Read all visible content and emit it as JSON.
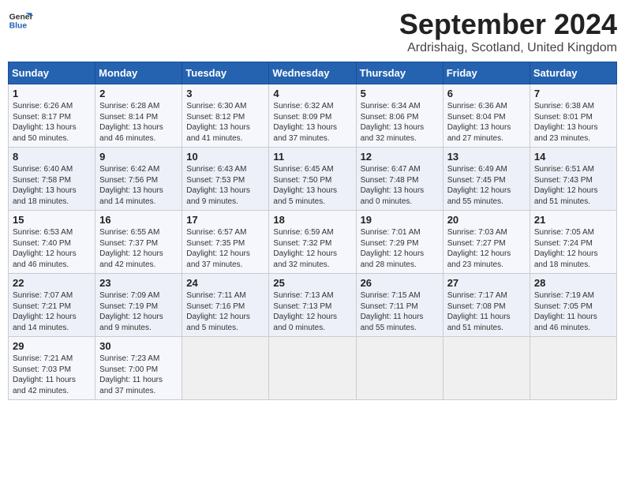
{
  "logo": {
    "line1": "General",
    "line2": "Blue"
  },
  "title": "September 2024",
  "subtitle": "Ardrishaig, Scotland, United Kingdom",
  "days_of_week": [
    "Sunday",
    "Monday",
    "Tuesday",
    "Wednesday",
    "Thursday",
    "Friday",
    "Saturday"
  ],
  "weeks": [
    [
      {
        "day": "1",
        "sunrise": "Sunrise: 6:26 AM",
        "sunset": "Sunset: 8:17 PM",
        "daylight": "Daylight: 13 hours and 50 minutes."
      },
      {
        "day": "2",
        "sunrise": "Sunrise: 6:28 AM",
        "sunset": "Sunset: 8:14 PM",
        "daylight": "Daylight: 13 hours and 46 minutes."
      },
      {
        "day": "3",
        "sunrise": "Sunrise: 6:30 AM",
        "sunset": "Sunset: 8:12 PM",
        "daylight": "Daylight: 13 hours and 41 minutes."
      },
      {
        "day": "4",
        "sunrise": "Sunrise: 6:32 AM",
        "sunset": "Sunset: 8:09 PM",
        "daylight": "Daylight: 13 hours and 37 minutes."
      },
      {
        "day": "5",
        "sunrise": "Sunrise: 6:34 AM",
        "sunset": "Sunset: 8:06 PM",
        "daylight": "Daylight: 13 hours and 32 minutes."
      },
      {
        "day": "6",
        "sunrise": "Sunrise: 6:36 AM",
        "sunset": "Sunset: 8:04 PM",
        "daylight": "Daylight: 13 hours and 27 minutes."
      },
      {
        "day": "7",
        "sunrise": "Sunrise: 6:38 AM",
        "sunset": "Sunset: 8:01 PM",
        "daylight": "Daylight: 13 hours and 23 minutes."
      }
    ],
    [
      {
        "day": "8",
        "sunrise": "Sunrise: 6:40 AM",
        "sunset": "Sunset: 7:58 PM",
        "daylight": "Daylight: 13 hours and 18 minutes."
      },
      {
        "day": "9",
        "sunrise": "Sunrise: 6:42 AM",
        "sunset": "Sunset: 7:56 PM",
        "daylight": "Daylight: 13 hours and 14 minutes."
      },
      {
        "day": "10",
        "sunrise": "Sunrise: 6:43 AM",
        "sunset": "Sunset: 7:53 PM",
        "daylight": "Daylight: 13 hours and 9 minutes."
      },
      {
        "day": "11",
        "sunrise": "Sunrise: 6:45 AM",
        "sunset": "Sunset: 7:50 PM",
        "daylight": "Daylight: 13 hours and 5 minutes."
      },
      {
        "day": "12",
        "sunrise": "Sunrise: 6:47 AM",
        "sunset": "Sunset: 7:48 PM",
        "daylight": "Daylight: 13 hours and 0 minutes."
      },
      {
        "day": "13",
        "sunrise": "Sunrise: 6:49 AM",
        "sunset": "Sunset: 7:45 PM",
        "daylight": "Daylight: 12 hours and 55 minutes."
      },
      {
        "day": "14",
        "sunrise": "Sunrise: 6:51 AM",
        "sunset": "Sunset: 7:43 PM",
        "daylight": "Daylight: 12 hours and 51 minutes."
      }
    ],
    [
      {
        "day": "15",
        "sunrise": "Sunrise: 6:53 AM",
        "sunset": "Sunset: 7:40 PM",
        "daylight": "Daylight: 12 hours and 46 minutes."
      },
      {
        "day": "16",
        "sunrise": "Sunrise: 6:55 AM",
        "sunset": "Sunset: 7:37 PM",
        "daylight": "Daylight: 12 hours and 42 minutes."
      },
      {
        "day": "17",
        "sunrise": "Sunrise: 6:57 AM",
        "sunset": "Sunset: 7:35 PM",
        "daylight": "Daylight: 12 hours and 37 minutes."
      },
      {
        "day": "18",
        "sunrise": "Sunrise: 6:59 AM",
        "sunset": "Sunset: 7:32 PM",
        "daylight": "Daylight: 12 hours and 32 minutes."
      },
      {
        "day": "19",
        "sunrise": "Sunrise: 7:01 AM",
        "sunset": "Sunset: 7:29 PM",
        "daylight": "Daylight: 12 hours and 28 minutes."
      },
      {
        "day": "20",
        "sunrise": "Sunrise: 7:03 AM",
        "sunset": "Sunset: 7:27 PM",
        "daylight": "Daylight: 12 hours and 23 minutes."
      },
      {
        "day": "21",
        "sunrise": "Sunrise: 7:05 AM",
        "sunset": "Sunset: 7:24 PM",
        "daylight": "Daylight: 12 hours and 18 minutes."
      }
    ],
    [
      {
        "day": "22",
        "sunrise": "Sunrise: 7:07 AM",
        "sunset": "Sunset: 7:21 PM",
        "daylight": "Daylight: 12 hours and 14 minutes."
      },
      {
        "day": "23",
        "sunrise": "Sunrise: 7:09 AM",
        "sunset": "Sunset: 7:19 PM",
        "daylight": "Daylight: 12 hours and 9 minutes."
      },
      {
        "day": "24",
        "sunrise": "Sunrise: 7:11 AM",
        "sunset": "Sunset: 7:16 PM",
        "daylight": "Daylight: 12 hours and 5 minutes."
      },
      {
        "day": "25",
        "sunrise": "Sunrise: 7:13 AM",
        "sunset": "Sunset: 7:13 PM",
        "daylight": "Daylight: 12 hours and 0 minutes."
      },
      {
        "day": "26",
        "sunrise": "Sunrise: 7:15 AM",
        "sunset": "Sunset: 7:11 PM",
        "daylight": "Daylight: 11 hours and 55 minutes."
      },
      {
        "day": "27",
        "sunrise": "Sunrise: 7:17 AM",
        "sunset": "Sunset: 7:08 PM",
        "daylight": "Daylight: 11 hours and 51 minutes."
      },
      {
        "day": "28",
        "sunrise": "Sunrise: 7:19 AM",
        "sunset": "Sunset: 7:05 PM",
        "daylight": "Daylight: 11 hours and 46 minutes."
      }
    ],
    [
      {
        "day": "29",
        "sunrise": "Sunrise: 7:21 AM",
        "sunset": "Sunset: 7:03 PM",
        "daylight": "Daylight: 11 hours and 42 minutes."
      },
      {
        "day": "30",
        "sunrise": "Sunrise: 7:23 AM",
        "sunset": "Sunset: 7:00 PM",
        "daylight": "Daylight: 11 hours and 37 minutes."
      },
      null,
      null,
      null,
      null,
      null
    ]
  ]
}
